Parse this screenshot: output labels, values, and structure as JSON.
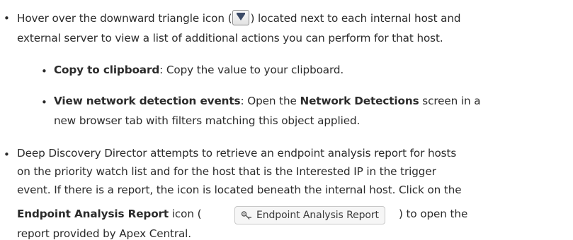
{
  "bullet_char": "•",
  "sub_bullet_char": "•",
  "item1": {
    "text_a": "Hover over the downward triangle icon (",
    "text_b": ") located next to each internal host and",
    "text_c": "external server to view a list of additional actions you can perform for that host."
  },
  "sub1": {
    "bold": "Copy to clipboard",
    "text": ": Copy the value to your clipboard."
  },
  "sub2": {
    "bold": "View network detection events",
    "text_a": ": Open the ",
    "bold2": "Network Detections",
    "text_b": " screen in a",
    "text_c": "new browser tab with filters matching this object applied."
  },
  "item2": {
    "line1": "Deep Discovery Director attempts to retrieve an endpoint analysis report for hosts",
    "line2": "on the priority watch list and for the host that is the Interested IP in the trigger",
    "line3": "event. If there is a report, the icon is located beneath the internal host. Click on the",
    "bold": "Endpoint Analysis Report",
    "text_a": " icon (",
    "text_b": ") to open the",
    "line5": "report provided by Apex Central.",
    "button_label": "Endpoint Analysis Report"
  }
}
